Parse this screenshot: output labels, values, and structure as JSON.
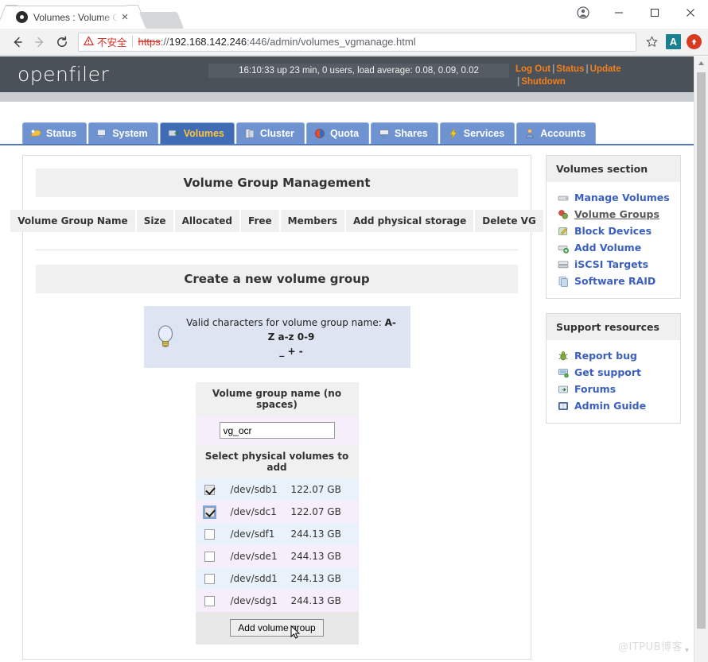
{
  "browser": {
    "tab": {
      "title": "Volumes : Volume Grou",
      "close_label": "×",
      "favicon": "openfiler-favicon"
    },
    "controls": {
      "profile": "profile-icon",
      "minimize": "minimize-icon",
      "maximize": "maximize-icon",
      "close": "close-icon"
    },
    "nav": {
      "back": "back-arrow-icon",
      "forward": "forward-arrow-icon",
      "reload": "reload-icon"
    },
    "omnibox": {
      "warning_icon": "⚠",
      "insecure_label": "不安全",
      "scheme": "https",
      "separator": "://",
      "host": "192.168.142.246",
      "rest": ":446/admin/volumes_vgmanage.html",
      "bookmark": "star-icon",
      "extension_a": "A",
      "extension_circle": "extension-icon"
    }
  },
  "header": {
    "logo": "openfiler",
    "uptime": "16:10:33 up 23 min, 0 users, load average: 0.08, 0.09, 0.02",
    "links": [
      {
        "label": "Log Out"
      },
      {
        "label": "Status"
      },
      {
        "label": "Update"
      },
      {
        "label": "Shutdown"
      }
    ],
    "link_separator": "|",
    "accent_color": "#f3801a",
    "background_color": "#4b5158"
  },
  "nav_tabs": [
    {
      "label": "Status",
      "icon": "status-icon",
      "active": false
    },
    {
      "label": "System",
      "icon": "system-icon",
      "active": false
    },
    {
      "label": "Volumes",
      "icon": "volumes-icon",
      "active": true
    },
    {
      "label": "Cluster",
      "icon": "cluster-icon",
      "active": false
    },
    {
      "label": "Quota",
      "icon": "quota-icon",
      "active": false
    },
    {
      "label": "Shares",
      "icon": "shares-icon",
      "active": false
    },
    {
      "label": "Services",
      "icon": "services-icon",
      "active": false
    },
    {
      "label": "Accounts",
      "icon": "accounts-icon",
      "active": false
    }
  ],
  "main": {
    "vg_management": {
      "title": "Volume Group Management",
      "columns": [
        "Volume Group Name",
        "Size",
        "Allocated",
        "Free",
        "Members",
        "Add physical storage",
        "Delete VG"
      ],
      "rows": []
    },
    "create_vg": {
      "title": "Create a new volume group",
      "tip": {
        "icon": "lightbulb-icon",
        "line1_prefix": "Valid characters for volume group name: ",
        "line1_bold": "A-Z a-z 0-9",
        "line2": "_ + -"
      },
      "name_label": "Volume group name (no spaces)",
      "name_value": "vg_ocr",
      "name_placeholder": "",
      "pv_label": "Select physical volumes to add",
      "physical_volumes": [
        {
          "device": "/dev/sdb1",
          "size": "122.07 GB",
          "checked": true,
          "focused": false
        },
        {
          "device": "/dev/sdc1",
          "size": "122.07 GB",
          "checked": true,
          "focused": true
        },
        {
          "device": "/dev/sdf1",
          "size": "244.13 GB",
          "checked": false,
          "focused": false
        },
        {
          "device": "/dev/sde1",
          "size": "244.13 GB",
          "checked": false,
          "focused": false
        },
        {
          "device": "/dev/sdd1",
          "size": "244.13 GB",
          "checked": false,
          "focused": false
        },
        {
          "device": "/dev/sdg1",
          "size": "244.13 GB",
          "checked": false,
          "focused": false
        }
      ],
      "submit_label": "Add volume group"
    }
  },
  "sidebar": {
    "volumes_section": {
      "title": "Volumes section",
      "items": [
        {
          "label": "Manage Volumes",
          "icon": "drive-icon",
          "current": false
        },
        {
          "label": "Volume Groups",
          "icon": "vgroup-icon",
          "current": true
        },
        {
          "label": "Block Devices",
          "icon": "block-icon",
          "current": false
        },
        {
          "label": "Add Volume",
          "icon": "addvol-icon",
          "current": false
        },
        {
          "label": "iSCSI Targets",
          "icon": "iscsi-icon",
          "current": false
        },
        {
          "label": "Software RAID",
          "icon": "raid-icon",
          "current": false
        }
      ]
    },
    "support_section": {
      "title": "Support resources",
      "items": [
        {
          "label": "Report bug",
          "icon": "bug-icon",
          "current": false
        },
        {
          "label": "Get support",
          "icon": "support-icon",
          "current": false
        },
        {
          "label": "Forums",
          "icon": "forum-icon",
          "current": false
        },
        {
          "label": "Admin Guide",
          "icon": "guide-icon",
          "current": false
        }
      ]
    }
  },
  "watermark": "@ITPUB博客"
}
